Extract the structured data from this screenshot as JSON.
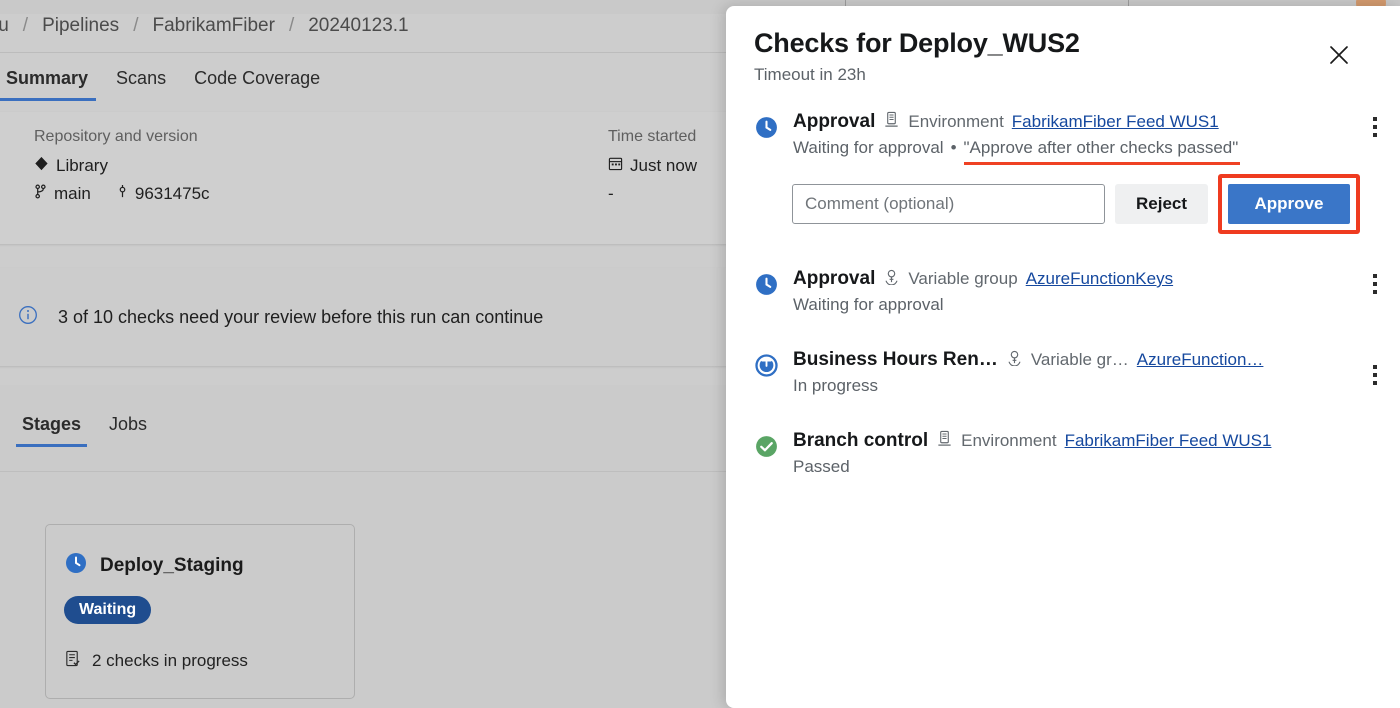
{
  "background": {
    "breadcrumb": {
      "items": [
        "iu",
        "Pipelines",
        "FabrikamFiber",
        "20240123.1"
      ],
      "separator": "/"
    },
    "main_tabs": [
      {
        "label": "Summary",
        "active": true
      },
      {
        "label": "Scans",
        "active": false
      },
      {
        "label": "Code Coverage",
        "active": false
      }
    ],
    "summary": {
      "repo_label": "Repository and version",
      "repo_name": "Library",
      "branch": "main",
      "commit": "9631475c",
      "time_label": "Time started",
      "time_value": "Just now",
      "elapsed_value": "-"
    },
    "info_banner": {
      "icon": "info-icon",
      "text": "3 of 10 checks need your review before this run can continue"
    },
    "stage_tabs": [
      {
        "label": "Stages",
        "active": true
      },
      {
        "label": "Jobs",
        "active": false
      }
    ],
    "stage_card": {
      "icon": "clock-icon",
      "name": "Deploy_Staging",
      "badge": "Waiting",
      "checks_icon": "checklist-icon",
      "checks_text": "2 checks in progress"
    }
  },
  "panel": {
    "title": "Checks for Deploy_WUS2",
    "subtitle": "Timeout in 23h",
    "close_icon": "close-icon",
    "checks": [
      {
        "status_icon": "clock-icon",
        "name": "Approval",
        "resource_icon": "environment-icon",
        "resource_kind": "Environment",
        "resource_link": "FabrikamFiber Feed WUS1",
        "substatus": "Waiting for approval",
        "separator": "•",
        "instruction": "\"Approve after other checks passed\"",
        "instruction_annotated": true,
        "menu_icon": "kebab-menu-icon",
        "actions": {
          "comment_value": "",
          "comment_placeholder": "Comment (optional)",
          "reject_label": "Reject",
          "approve_label": "Approve",
          "approve_annotated": true
        }
      },
      {
        "status_icon": "clock-icon",
        "name": "Approval",
        "resource_icon": "variable-group-icon",
        "resource_kind": "Variable group",
        "resource_link": "AzureFunctionKeys",
        "substatus": "Waiting for approval",
        "menu_icon": "kebab-menu-icon"
      },
      {
        "status_icon": "in-progress-icon",
        "name": "Business Hours Ren…",
        "resource_icon": "variable-group-icon",
        "resource_kind": "Variable gr…",
        "resource_link": "AzureFunction…",
        "substatus": "In progress",
        "menu_icon": "kebab-menu-icon"
      },
      {
        "status_icon": "success-check-icon",
        "name": "Branch control",
        "resource_icon": "environment-icon",
        "resource_kind": "Environment",
        "resource_link": "FabrikamFiber Feed WUS1",
        "substatus": "Passed"
      }
    ]
  },
  "colors": {
    "accent_blue": "#3a76c8",
    "link_blue": "#15489e",
    "annotation_red": "#ef3b20",
    "success_green": "#5aa565",
    "badge_blue": "#1f4d8f"
  }
}
